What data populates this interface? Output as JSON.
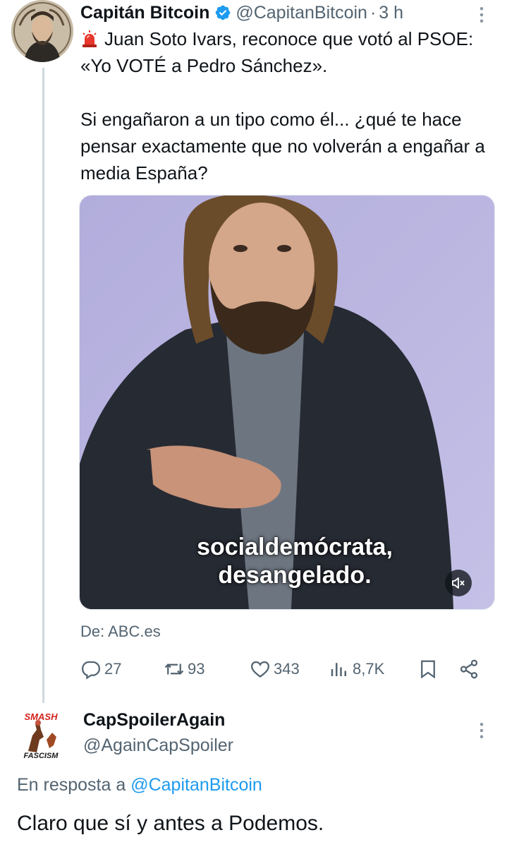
{
  "tweet": {
    "author_name": "Capitán Bitcoin",
    "author_handle": "@CapitanBitcoin",
    "separator": "·",
    "time": "3 h",
    "text_line1": "Juan Soto Ivars, reconoce que votó al PSOE: «Yo VOTÉ a Pedro Sánchez».",
    "text_line2": "Si engañaron a un tipo como él... ¿qué te hace pensar exactamente que no volverán a engañar a media España?",
    "media": {
      "subtitle_line1": "socialdemócrata,",
      "subtitle_line2": "desangelado."
    },
    "source": "De: ABC.es",
    "actions": {
      "replies": "27",
      "retweets": "93",
      "likes": "343",
      "views": "8,7K"
    }
  },
  "reply": {
    "author_name": "CapSpoilerAgain",
    "author_handle": "@AgainCapSpoiler",
    "avatar_text_top": "SMASH",
    "avatar_text_bottom": "FASCISM",
    "reply_to_prefix": "En resposta a ",
    "reply_to_mention": "@CapitanBitcoin",
    "text": "Claro que sí y antes a Podemos."
  },
  "colors": {
    "text": "#0f1419",
    "secondary": "#536471",
    "link": "#1d9bf0",
    "verified": "#1d9bf0",
    "siren": "#e8372c",
    "thread_line": "#cfd9de"
  },
  "icons": [
    "more-icon",
    "verified-badge-icon",
    "siren-icon",
    "mute-icon",
    "reply-icon",
    "retweet-icon",
    "like-icon",
    "views-icon",
    "bookmark-icon",
    "share-icon"
  ]
}
